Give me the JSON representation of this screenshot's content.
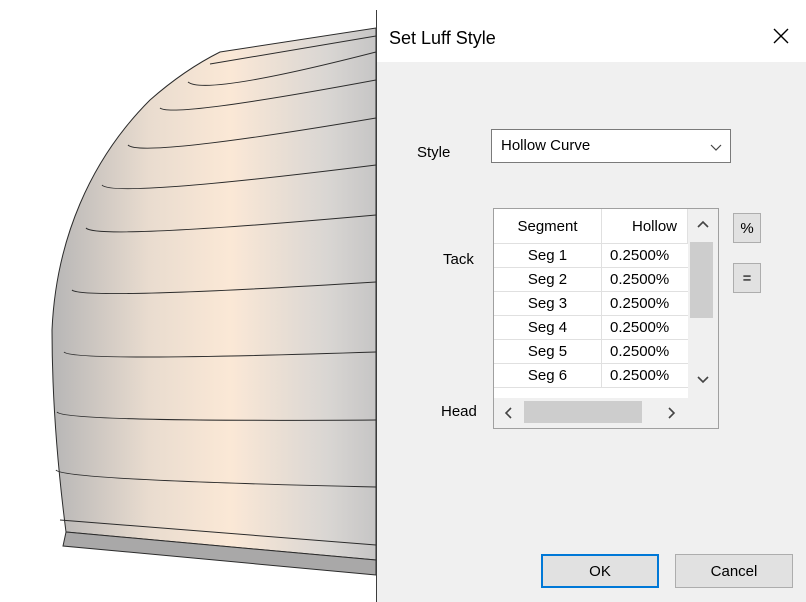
{
  "dialog": {
    "title": "Set Luff Style",
    "style_label": "Style",
    "style_value": "Hollow Curve",
    "tack_label": "Tack",
    "head_label": "Head",
    "grid": {
      "columns": [
        "Segment",
        "Hollow"
      ],
      "rows": [
        {
          "segment": "Seg 1",
          "hollow": "0.2500%"
        },
        {
          "segment": "Seg 2",
          "hollow": "0.2500%"
        },
        {
          "segment": "Seg 3",
          "hollow": "0.2500%"
        },
        {
          "segment": "Seg 4",
          "hollow": "0.2500%"
        },
        {
          "segment": "Seg 5",
          "hollow": "0.2500%"
        },
        {
          "segment": "Seg 6",
          "hollow": "0.2500%"
        }
      ]
    },
    "percent_button": "%",
    "equal_button": "=",
    "ok_button": "OK",
    "cancel_button": "Cancel"
  },
  "colors": {
    "accent": "#0078d7",
    "dialog_bg": "#f0f0f0",
    "sail_highlight": "#fbe8d6",
    "sail_shadow": "#bdbcbc"
  },
  "icons": {
    "close": "close-icon",
    "dropdown": "chevron-down-icon",
    "scroll_up": "chevron-up-icon",
    "scroll_down": "chevron-down-icon",
    "scroll_left": "chevron-left-icon",
    "scroll_right": "chevron-right-icon"
  }
}
